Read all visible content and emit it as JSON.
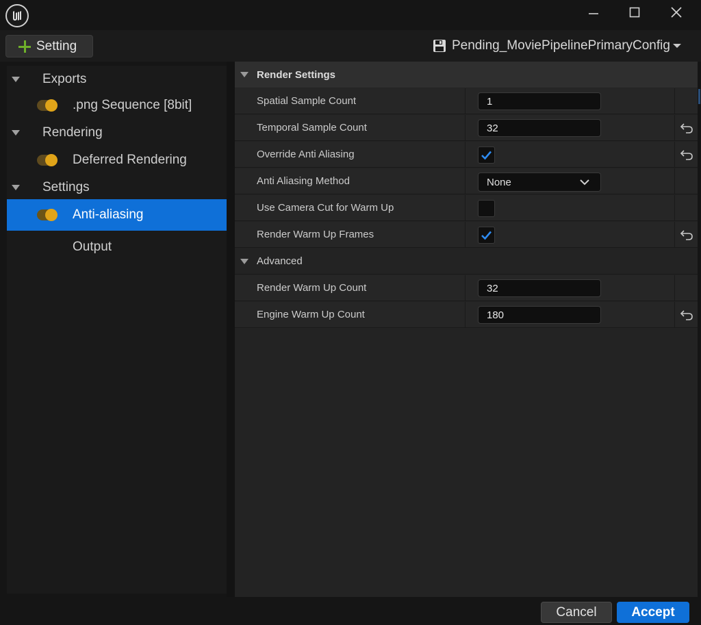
{
  "window": {
    "logo": "unreal-logo"
  },
  "toolbar": {
    "add_setting_label": "Setting",
    "config_name": "Pending_MoviePipelinePrimaryConfig"
  },
  "tree": {
    "exports": {
      "label": "Exports"
    },
    "png_sequence": {
      "label": ".png Sequence [8bit]"
    },
    "rendering": {
      "label": "Rendering"
    },
    "deferred_rendering": {
      "label": "Deferred Rendering"
    },
    "settings": {
      "label": "Settings"
    },
    "anti_aliasing": {
      "label": "Anti-aliasing"
    },
    "output": {
      "label": "Output"
    }
  },
  "details": {
    "render_settings": {
      "header": "Render Settings",
      "spatial_sample_count": {
        "label": "Spatial Sample Count",
        "value": "1"
      },
      "temporal_sample_count": {
        "label": "Temporal Sample Count",
        "value": "32"
      },
      "override_anti_aliasing": {
        "label": "Override Anti Aliasing",
        "checked": true
      },
      "anti_aliasing_method": {
        "label": "Anti Aliasing Method",
        "value": "None"
      },
      "use_camera_cut_for_warm_up": {
        "label": "Use Camera Cut for Warm Up",
        "checked": false
      },
      "render_warm_up_frames": {
        "label": "Render Warm Up Frames",
        "checked": true
      }
    },
    "advanced": {
      "header": "Advanced",
      "render_warm_up_count": {
        "label": "Render Warm Up Count",
        "value": "32"
      },
      "engine_warm_up_count": {
        "label": "Engine Warm Up Count",
        "value": "180"
      }
    }
  },
  "footer": {
    "cancel_label": "Cancel",
    "accept_label": "Accept"
  },
  "colors": {
    "accent": "#0f70d8",
    "toggle_on": "#e0a419",
    "check": "#2e8bf0",
    "add_icon": "#6fb02a"
  }
}
